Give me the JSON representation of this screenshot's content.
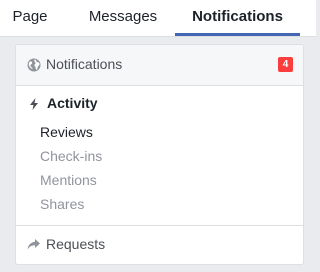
{
  "tabs": {
    "page": "Page",
    "messages": "Messages",
    "notifications": "Notifications"
  },
  "panel": {
    "header": {
      "label": "Notifications",
      "badge_count": "4",
      "icon": "globe-icon"
    },
    "activity": {
      "label": "Activity",
      "icon": "bolt-icon",
      "items": [
        {
          "label": "Reviews"
        },
        {
          "label": "Check-ins"
        },
        {
          "label": "Mentions"
        },
        {
          "label": "Shares"
        }
      ]
    },
    "requests": {
      "label": "Requests",
      "icon": "share-arrow-icon"
    }
  },
  "colors": {
    "accent": "#4267b2",
    "badge": "#fa3e3e",
    "background": "#e9ebee"
  }
}
